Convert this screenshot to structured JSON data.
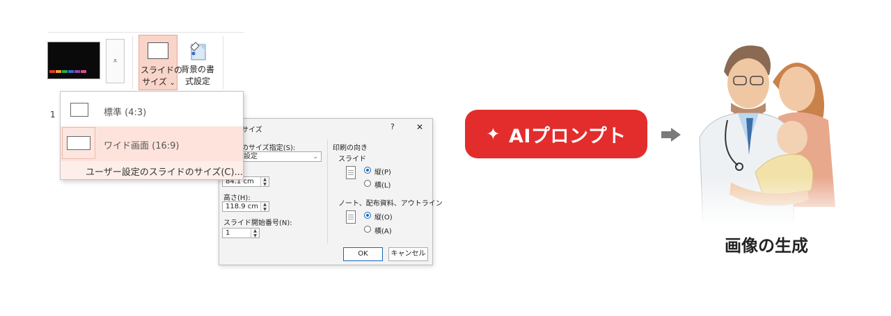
{
  "ribbon": {
    "slide_size_line1": "スライドの",
    "slide_size_line2": "サイズ",
    "slide_size_chevron": "⌄",
    "bg_format_line1": "背景の書",
    "bg_format_line2": "式設定",
    "more_glyph": "⩡",
    "left_fragment": "1"
  },
  "menu": {
    "standard_label": "標準 (4:3)",
    "widescreen_label": "ワイド画面 (16:9)",
    "custom_label": "ユーザー設定のスライドのサイズ(C)..."
  },
  "dialog": {
    "title": "のサイズ",
    "help_glyph": "?",
    "close_glyph": "✕",
    "size_for_label": "のサイズ指定(S):",
    "size_for_value": "設定",
    "width_label": ":",
    "width_value": "84.1 cm",
    "height_label": "高さ(H):",
    "height_value": "118.9 cm",
    "number_from_label": "スライド開始番号(N):",
    "number_from_value": "1",
    "orientation_label": "印刷の向き",
    "slides_label": "スライド",
    "slides_portrait": "縦(P)",
    "slides_landscape": "横(L)",
    "notes_label": "ノート、配布資料、アウトライン",
    "notes_portrait": "縦(O)",
    "notes_landscape": "横(A)",
    "ok_label": "OK",
    "cancel_label": "キャンセル"
  },
  "ai_badge": {
    "spark": "✦",
    "label": "AIプロンプト"
  },
  "caption": "画像の生成",
  "icons": {
    "theme_colors": [
      "#e03c31",
      "#f0a030",
      "#2eaa4a",
      "#2f6fd0",
      "#8e44ad",
      "#d94f8c"
    ],
    "accent_red": "#e32d2d",
    "selected_fill": "#f9d4c9"
  }
}
